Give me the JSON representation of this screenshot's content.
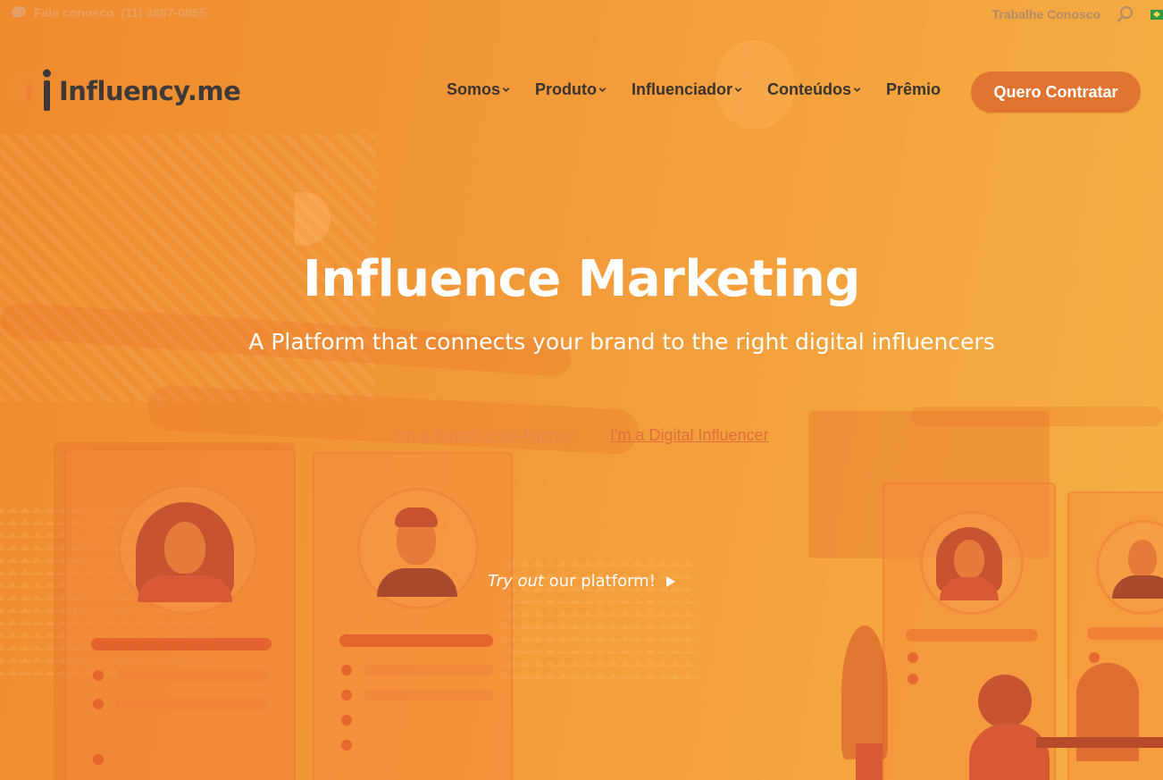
{
  "topbar": {
    "contact_label": "Fale conosco",
    "phone": "(11) 3897-0855",
    "work_with_us": "Trabalhe Conosco",
    "icons": {
      "chat": "chat-bubble-icon",
      "search": "search-icon",
      "flag": "brazil-flag-icon"
    }
  },
  "header": {
    "logo_text": "Influency.me",
    "nav": [
      {
        "label": "Somos",
        "has_dropdown": true
      },
      {
        "label": "Produto",
        "has_dropdown": true
      },
      {
        "label": "Influenciador",
        "has_dropdown": true
      },
      {
        "label": "Conteúdos",
        "has_dropdown": true
      },
      {
        "label": "Prêmio",
        "has_dropdown": false
      }
    ],
    "cta_label": "Quero Contratar"
  },
  "hero": {
    "title": "Influence Marketing",
    "subtitle": "A Platform that connects your brand to the right digital influencers",
    "link_brand": "I'm a Brand or an Agency",
    "link_influencer": "I'm a Digital Influencer",
    "try_italic": "Try out",
    "try_rest": "our platform!"
  },
  "colors": {
    "background_start": "#ef8a2e",
    "background_end": "#f5b043",
    "cta": "#e27431",
    "nav_text": "#3a3330",
    "hero_text": "#ffffff"
  }
}
